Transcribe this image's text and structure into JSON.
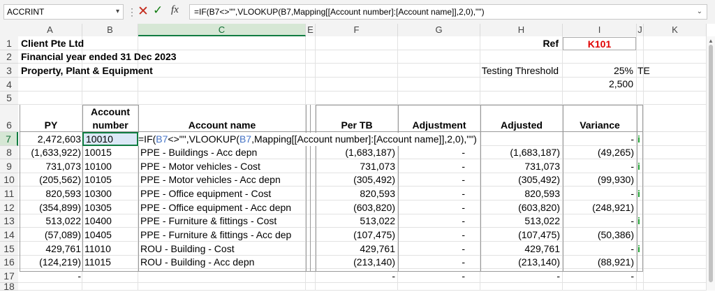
{
  "formula_bar": {
    "name_box": "ACCRINT",
    "formula": "=IF(B7<>\"\",VLOOKUP(B7,Mapping[[Account number]:[Account name]],2,0),\"\")"
  },
  "columns": [
    "A",
    "B",
    "C",
    "E",
    "F",
    "G",
    "H",
    "I",
    "J",
    "K"
  ],
  "rows": [
    "1",
    "2",
    "3",
    "4",
    "5",
    "6",
    "7",
    "8",
    "9",
    "10",
    "11",
    "12",
    "13",
    "14",
    "15",
    "16",
    "17",
    "18"
  ],
  "header": {
    "company": "Client Pte Ltd",
    "period": "Financial year ended 31 Dec 2023",
    "section": "Property, Plant & Equipment",
    "ref_label": "Ref",
    "ref_value": "K101",
    "threshold_label": "Testing Threshold",
    "threshold_pct": "25%",
    "threshold_code": "TE",
    "threshold_amount": "2,500"
  },
  "table_headers": {
    "py": "PY",
    "account_number_1": "Account",
    "account_number_2": "number",
    "account_name": "Account name",
    "per_tb": "Per TB",
    "adjustment": "Adjustment",
    "adjusted": "Adjusted",
    "variance": "Variance"
  },
  "editing": {
    "pre": "=IF(",
    "ref1": "B7",
    "mid": "<>\"\",VLOOKUP(",
    "ref2": "B7",
    "post": ",Mapping[[Account number]:[Account name]],2,0),\"\")"
  },
  "table_rows": [
    {
      "py": "2,472,603",
      "acct": "10010",
      "name": "",
      "per_tb": "",
      "adj": "",
      "adjusted": "",
      "variance": "-",
      "flag": "i"
    },
    {
      "py": "(1,633,922)",
      "acct": "10015",
      "name": "PPE - Buildings - Acc depn",
      "per_tb": "(1,683,187)",
      "adj": "-",
      "adjusted": "(1,683,187)",
      "variance": "(49,265)",
      "flag": ""
    },
    {
      "py": "731,073",
      "acct": "10100",
      "name": "PPE - Motor vehicles - Cost",
      "per_tb": "731,073",
      "adj": "-",
      "adjusted": "731,073",
      "variance": "-",
      "flag": "i"
    },
    {
      "py": "(205,562)",
      "acct": "10105",
      "name": "PPE - Motor vehicles - Acc depn",
      "per_tb": "(305,492)",
      "adj": "-",
      "adjusted": "(305,492)",
      "variance": "(99,930)",
      "flag": ""
    },
    {
      "py": "820,593",
      "acct": "10300",
      "name": "PPE - Office equipment - Cost",
      "per_tb": "820,593",
      "adj": "-",
      "adjusted": "820,593",
      "variance": "-",
      "flag": "i"
    },
    {
      "py": "(354,899)",
      "acct": "10305",
      "name": "PPE - Office equipment - Acc depn",
      "per_tb": "(603,820)",
      "adj": "-",
      "adjusted": "(603,820)",
      "variance": "(248,921)",
      "flag": ""
    },
    {
      "py": "513,022",
      "acct": "10400",
      "name": "PPE - Furniture & fittings - Cost",
      "per_tb": "513,022",
      "adj": "-",
      "adjusted": "513,022",
      "variance": "-",
      "flag": "i"
    },
    {
      "py": "(57,089)",
      "acct": "10405",
      "name": "PPE - Furniture & fittings - Acc dep",
      "per_tb": "(107,475)",
      "adj": "-",
      "adjusted": "(107,475)",
      "variance": "(50,386)",
      "flag": ""
    },
    {
      "py": "429,761",
      "acct": "11010",
      "name": "ROU - Building - Cost",
      "per_tb": "429,761",
      "adj": "-",
      "adjusted": "429,761",
      "variance": "-",
      "flag": "i"
    },
    {
      "py": "(124,219)",
      "acct": "11015",
      "name": "ROU - Building - Acc depn",
      "per_tb": "(213,140)",
      "adj": "-",
      "adjusted": "(213,140)",
      "variance": "(88,921)",
      "flag": ""
    },
    {
      "py": "-",
      "acct": "",
      "name": "",
      "per_tb": "-",
      "adj": "-",
      "adjusted": "-",
      "variance": "-",
      "flag": ""
    }
  ],
  "colors": {
    "accent_green": "#107c41",
    "ref_red": "#e00000",
    "flag_green": "#1a9e2c",
    "range_blue": "#4472c4"
  }
}
